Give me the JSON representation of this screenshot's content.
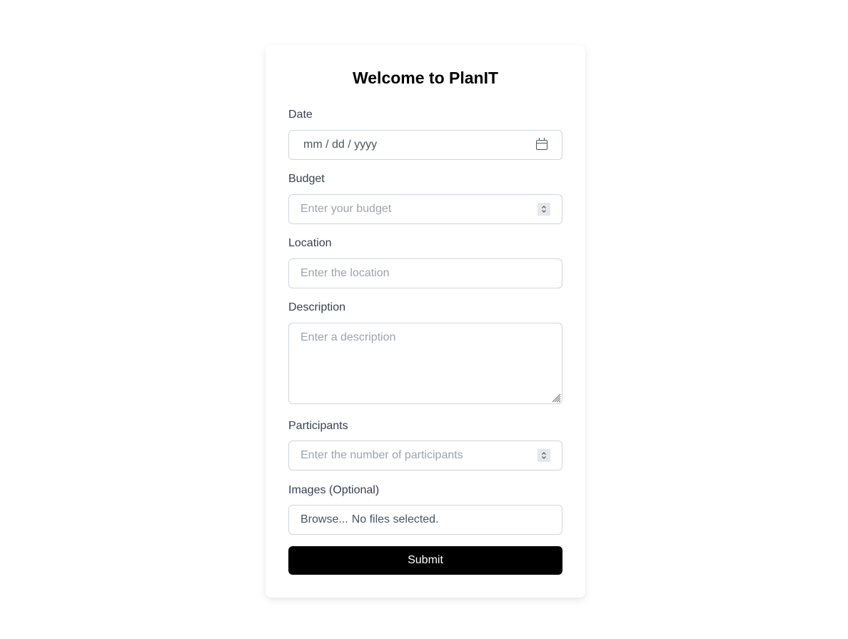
{
  "form": {
    "title": "Welcome to PlanIT",
    "date": {
      "label": "Date",
      "placeholder": "mm / dd / yyyy",
      "icon": "calendar-icon"
    },
    "budget": {
      "label": "Budget",
      "placeholder": "Enter your budget",
      "icon": "spinner-icon"
    },
    "location": {
      "label": "Location",
      "placeholder": "Enter the location"
    },
    "description": {
      "label": "Description",
      "placeholder": "Enter a description"
    },
    "participants": {
      "label": "Participants",
      "placeholder": "Enter the number of participants",
      "icon": "spinner-icon"
    },
    "images": {
      "label": "Images (Optional)",
      "button_label": "Browse...",
      "status": "No files selected."
    },
    "submit_label": "Submit"
  },
  "colors": {
    "accent": "#000000",
    "label": "#374151",
    "placeholder": "#9ca3af",
    "border": "#d1d5db"
  }
}
